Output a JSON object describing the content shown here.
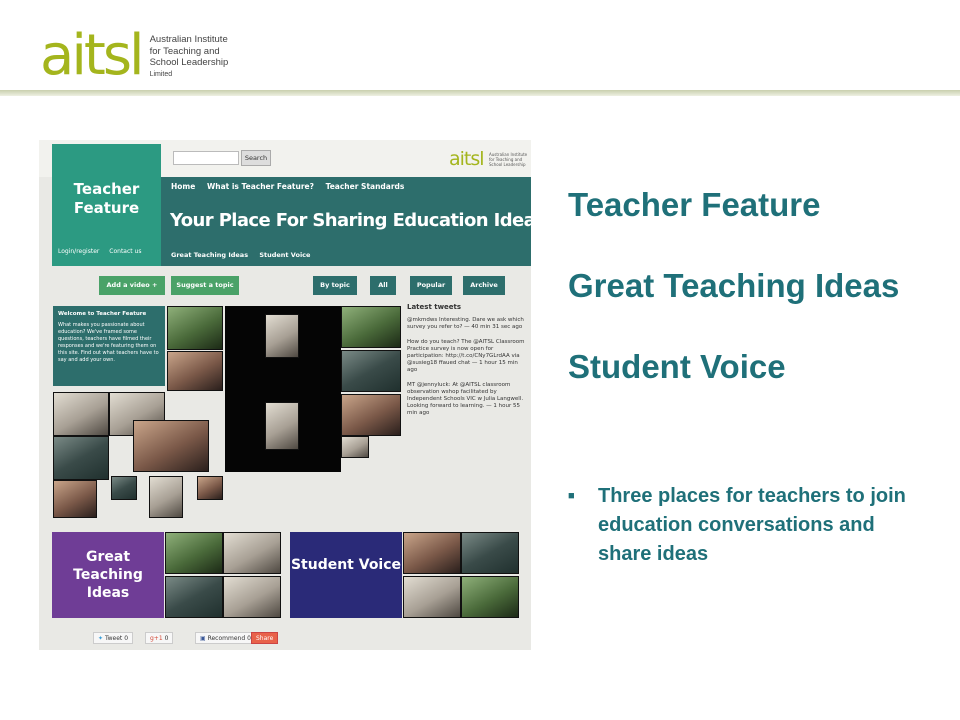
{
  "logo": {
    "wordmark": "aitsl",
    "subtitle_lines": [
      "Australian Institute",
      "for Teaching and",
      "School Leadership",
      "Limited"
    ],
    "colors": {
      "lime": "#a4b51d",
      "green": "#6b8e2a"
    }
  },
  "headings": [
    "Teacher Feature",
    "Great Teaching Ideas",
    "Student Voice"
  ],
  "bullet": {
    "icon": "square-bullet-icon",
    "text": "Three places for teachers to join education conversations and share ideas"
  },
  "accent_color": "#1f7079",
  "website": {
    "brand": "Teacher Feature",
    "brand_links": [
      "Login/register",
      "Contact us"
    ],
    "search_button": "Search",
    "site_logo": "aitsl",
    "site_logo_sub": "Australian Institute for Teaching and School Leadership",
    "nav_top": [
      "Home",
      "What is Teacher Feature?",
      "Teacher Standards"
    ],
    "banner": "Your Place For Sharing Education Ideas.",
    "nav_bottom": [
      "Great Teaching Ideas",
      "Student Voice"
    ],
    "buttons": {
      "add_video": "Add a video +",
      "suggest_topic": "Suggest a topic",
      "by_topic": "By topic",
      "all": "All",
      "popular": "Popular",
      "archive": "Archive"
    },
    "welcome": {
      "title": "Welcome to Teacher Feature",
      "body": "What makes you passionate about education? We've framed some questions, teachers have filmed their responses and we're featuring them on this site. Find out what teachers have to say and add your own."
    },
    "tweets": {
      "title": "Latest tweets",
      "items": [
        "@mkmdws Interesting. Dare we ask which survey you refer to? — 40 min 31 sec ago",
        "How do you teach? The @AITSL Classroom Practice survey is now open for participation: http://t.co/CNy7GLrdAA via @susieg18 ffaued chat — 1 hour 15 min ago",
        "MT @jennyluck: At @AITSL classroom observation wshop facilitated by Independent Schools VIC w Julia Langwell. Looking forward to learning. — 1 hour 55 min ago"
      ]
    },
    "panels": {
      "great_teaching_ideas": "Great Teaching Ideas",
      "student_voice": "Student Voice"
    },
    "social": {
      "tweet": "Tweet",
      "tweet_count": "0",
      "gplus": "g+1",
      "gplus_count": "0",
      "recommend": "Recommend",
      "recommend_count": "0",
      "share": "Share"
    }
  }
}
